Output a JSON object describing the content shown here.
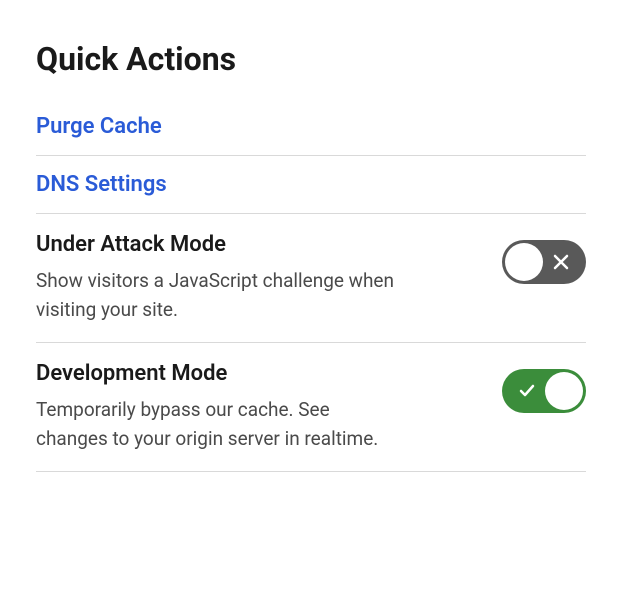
{
  "title": "Quick Actions",
  "links": [
    {
      "label": "Purge Cache"
    },
    {
      "label": "DNS Settings"
    }
  ],
  "toggles": [
    {
      "title": "Under Attack Mode",
      "description": "Show visitors a JavaScript challenge when visiting your site.",
      "state": "off"
    },
    {
      "title": "Development Mode",
      "description": "Temporarily bypass our cache. See changes to your origin server in realtime.",
      "state": "on"
    }
  ]
}
